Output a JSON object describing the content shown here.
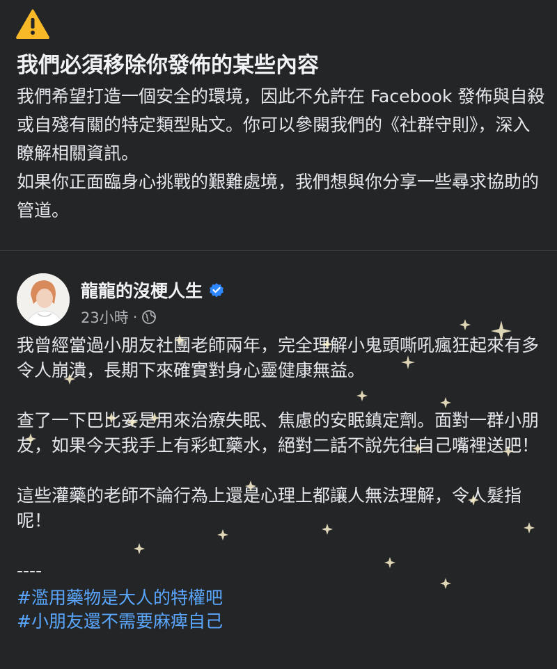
{
  "notice": {
    "icon": "warning-triangle-icon",
    "icon_color": "#f7b928",
    "title": "我們必須移除你發佈的某些內容",
    "paragraph1": "我們希望打造一個安全的環境，因此不允許在 Facebook 發佈與自殺或自殘有關的特定類型貼文。你可以參閱我們的《社群守則》，深入瞭解相關資訊。",
    "paragraph2": "如果你正面臨身心挑戰的艱難處境，我們想與你分享一些尋求協助的管道。"
  },
  "post": {
    "author": "龍龍的沒梗人生",
    "verified_icon": "verified-badge-icon",
    "time": "23小時",
    "separator": "·",
    "audience_icon": "globe-icon",
    "paragraph1": "我曾經當過小朋友社團老師兩年，完全理解小鬼頭嘶吼瘋狂起來有多令人崩潰，長期下來確實對身心靈健康無益。",
    "paragraph2": "查了一下巴比妥是用來治療失眠、焦慮的安眠鎮定劑。面對一群小朋友，如果今天我手上有彩虹藥水，絕對二話不說先往自己嘴裡送吧！",
    "paragraph3": "這些灌藥的老師不論行為上還是心理上都讓人無法理解，令人髮指呢！",
    "dashes": "----",
    "hashtags": [
      "#濫用藥物是大人的特權吧",
      "#小朋友還不需要麻痺自己"
    ],
    "hashtag_color": "#5aa7ff"
  }
}
